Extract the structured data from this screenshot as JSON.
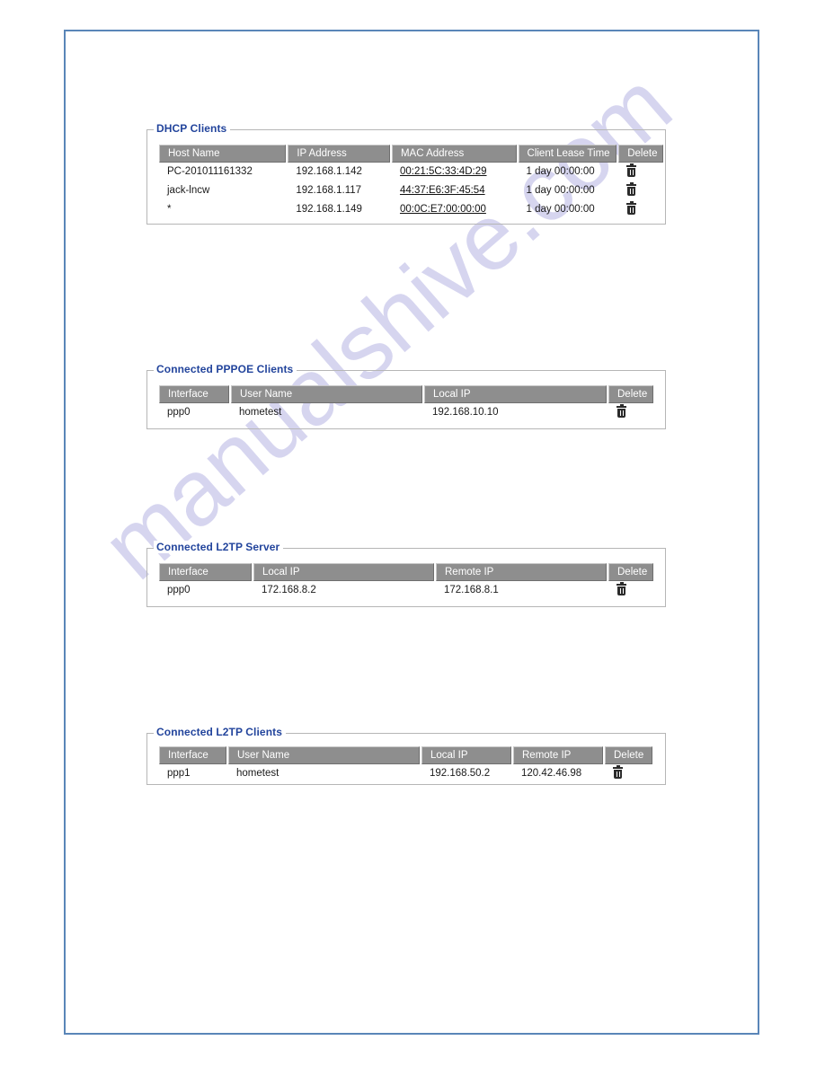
{
  "page": {
    "border_color": "#5a86b8",
    "background": "#ffffff",
    "watermark": "manualshive.com",
    "watermark_color": "#c7c6ea"
  },
  "theme": {
    "legend_color": "#22449c",
    "header_bg": "#8e8e8e",
    "header_text": "#ffffff",
    "panel_border": "#b6b6b6"
  },
  "icons": {
    "delete": "trash-icon"
  },
  "panels": [
    {
      "id": "dhcp",
      "legend": "DHCP Clients",
      "columns": [
        "Host Name",
        "IP Address",
        "MAC Address",
        "Client Lease Time",
        "Delete"
      ],
      "rows": [
        {
          "host_name": "PC-201011161332",
          "ip_address": "192.168.1.142",
          "mac_address": "00:21:5C:33:4D:29",
          "lease_time": "1 day 00:00:00",
          "delete": "trash-icon"
        },
        {
          "host_name": "jack-lncw",
          "ip_address": "192.168.1.117",
          "mac_address": "44:37:E6:3F:45:54",
          "lease_time": "1 day 00:00:00",
          "delete": "trash-icon"
        },
        {
          "host_name": "*",
          "ip_address": "192.168.1.149",
          "mac_address": "00:0C:E7:00:00:00",
          "lease_time": "1 day 00:00:00",
          "delete": "trash-icon"
        }
      ]
    },
    {
      "id": "pppoe",
      "legend": "Connected PPPOE Clients",
      "columns": [
        "Interface",
        "User Name",
        "Local IP",
        "Delete"
      ],
      "rows": [
        {
          "interface": "ppp0",
          "user_name": "hometest",
          "local_ip": "192.168.10.10",
          "delete": "trash-icon"
        }
      ]
    },
    {
      "id": "l2tp-server",
      "legend": "Connected L2TP Server",
      "columns": [
        "Interface",
        "Local IP",
        "Remote IP",
        "Delete"
      ],
      "rows": [
        {
          "interface": "ppp0",
          "local_ip": "172.168.8.2",
          "remote_ip": "172.168.8.1",
          "delete": "trash-icon"
        }
      ]
    },
    {
      "id": "l2tp-client",
      "legend": "Connected L2TP Clients",
      "columns": [
        "Interface",
        "User Name",
        "Local IP",
        "Remote IP",
        "Delete"
      ],
      "rows": [
        {
          "interface": "ppp1",
          "user_name": "hometest",
          "local_ip": "192.168.50.2",
          "remote_ip": "120.42.46.98",
          "delete": "trash-icon"
        }
      ]
    }
  ]
}
